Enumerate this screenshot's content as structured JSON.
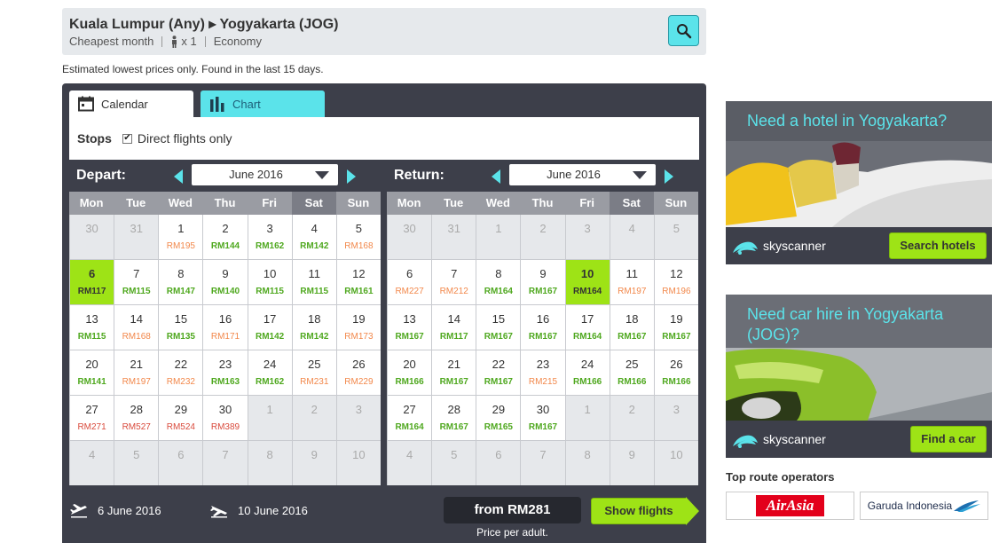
{
  "search": {
    "route": "Kuala Lumpur (Any) ▸ Yogyakarta (JOG)",
    "when": "Cheapest month",
    "passengers": "x 1",
    "cabin": "Economy",
    "note": "Estimated lowest prices only. Found in the last 15 days."
  },
  "tabs": {
    "calendar": "Calendar",
    "chart": "Chart"
  },
  "filters": {
    "stops_label": "Stops",
    "direct_label": "Direct flights only",
    "direct_checked": "✔"
  },
  "days": [
    "Mon",
    "Tue",
    "Wed",
    "Thu",
    "Fri",
    "Sat",
    "Sun"
  ],
  "depart": {
    "label": "Depart:",
    "month": "June 2016",
    "cells": [
      {
        "d": "30",
        "p": "",
        "c": "",
        "out": true
      },
      {
        "d": "31",
        "p": "",
        "c": "",
        "out": true
      },
      {
        "d": "1",
        "p": "RM195",
        "c": "orange"
      },
      {
        "d": "2",
        "p": "RM144",
        "c": "green"
      },
      {
        "d": "3",
        "p": "RM162",
        "c": "green"
      },
      {
        "d": "4",
        "p": "RM142",
        "c": "green"
      },
      {
        "d": "5",
        "p": "RM168",
        "c": "orange"
      },
      {
        "d": "6",
        "p": "RM117",
        "c": "green",
        "sel": true
      },
      {
        "d": "7",
        "p": "RM115",
        "c": "green"
      },
      {
        "d": "8",
        "p": "RM147",
        "c": "green"
      },
      {
        "d": "9",
        "p": "RM140",
        "c": "green"
      },
      {
        "d": "10",
        "p": "RM115",
        "c": "green"
      },
      {
        "d": "11",
        "p": "RM115",
        "c": "green"
      },
      {
        "d": "12",
        "p": "RM161",
        "c": "green"
      },
      {
        "d": "13",
        "p": "RM115",
        "c": "green"
      },
      {
        "d": "14",
        "p": "RM168",
        "c": "orange"
      },
      {
        "d": "15",
        "p": "RM135",
        "c": "green"
      },
      {
        "d": "16",
        "p": "RM171",
        "c": "orange"
      },
      {
        "d": "17",
        "p": "RM142",
        "c": "green"
      },
      {
        "d": "18",
        "p": "RM142",
        "c": "green"
      },
      {
        "d": "19",
        "p": "RM173",
        "c": "orange"
      },
      {
        "d": "20",
        "p": "RM141",
        "c": "green"
      },
      {
        "d": "21",
        "p": "RM197",
        "c": "orange"
      },
      {
        "d": "22",
        "p": "RM232",
        "c": "orange"
      },
      {
        "d": "23",
        "p": "RM163",
        "c": "green"
      },
      {
        "d": "24",
        "p": "RM162",
        "c": "green"
      },
      {
        "d": "25",
        "p": "RM231",
        "c": "orange"
      },
      {
        "d": "26",
        "p": "RM229",
        "c": "orange"
      },
      {
        "d": "27",
        "p": "RM271",
        "c": "red"
      },
      {
        "d": "28",
        "p": "RM527",
        "c": "red"
      },
      {
        "d": "29",
        "p": "RM524",
        "c": "red"
      },
      {
        "d": "30",
        "p": "RM389",
        "c": "red"
      },
      {
        "d": "1",
        "p": "",
        "c": "",
        "out": true
      },
      {
        "d": "2",
        "p": "",
        "c": "",
        "out": true
      },
      {
        "d": "3",
        "p": "",
        "c": "",
        "out": true
      },
      {
        "d": "4",
        "p": "",
        "c": "",
        "out": true
      },
      {
        "d": "5",
        "p": "",
        "c": "",
        "out": true
      },
      {
        "d": "6",
        "p": "",
        "c": "",
        "out": true
      },
      {
        "d": "7",
        "p": "",
        "c": "",
        "out": true
      },
      {
        "d": "8",
        "p": "",
        "c": "",
        "out": true
      },
      {
        "d": "9",
        "p": "",
        "c": "",
        "out": true
      },
      {
        "d": "10",
        "p": "",
        "c": "",
        "out": true
      }
    ]
  },
  "return": {
    "label": "Return:",
    "month": "June 2016",
    "cells": [
      {
        "d": "30",
        "p": "",
        "c": "",
        "out": true
      },
      {
        "d": "31",
        "p": "",
        "c": "",
        "out": true
      },
      {
        "d": "1",
        "p": "",
        "c": "",
        "out": true
      },
      {
        "d": "2",
        "p": "",
        "c": "",
        "out": true
      },
      {
        "d": "3",
        "p": "",
        "c": "",
        "out": true
      },
      {
        "d": "4",
        "p": "",
        "c": "",
        "out": true
      },
      {
        "d": "5",
        "p": "",
        "c": "",
        "out": true
      },
      {
        "d": "6",
        "p": "RM227",
        "c": "orange"
      },
      {
        "d": "7",
        "p": "RM212",
        "c": "orange"
      },
      {
        "d": "8",
        "p": "RM164",
        "c": "green"
      },
      {
        "d": "9",
        "p": "RM167",
        "c": "green"
      },
      {
        "d": "10",
        "p": "RM164",
        "c": "green",
        "sel": true
      },
      {
        "d": "11",
        "p": "RM197",
        "c": "orange"
      },
      {
        "d": "12",
        "p": "RM196",
        "c": "orange"
      },
      {
        "d": "13",
        "p": "RM167",
        "c": "green"
      },
      {
        "d": "14",
        "p": "RM117",
        "c": "green"
      },
      {
        "d": "15",
        "p": "RM167",
        "c": "green"
      },
      {
        "d": "16",
        "p": "RM167",
        "c": "green"
      },
      {
        "d": "17",
        "p": "RM164",
        "c": "green"
      },
      {
        "d": "18",
        "p": "RM167",
        "c": "green"
      },
      {
        "d": "19",
        "p": "RM167",
        "c": "green"
      },
      {
        "d": "20",
        "p": "RM166",
        "c": "green"
      },
      {
        "d": "21",
        "p": "RM167",
        "c": "green"
      },
      {
        "d": "22",
        "p": "RM167",
        "c": "green"
      },
      {
        "d": "23",
        "p": "RM215",
        "c": "orange"
      },
      {
        "d": "24",
        "p": "RM166",
        "c": "green"
      },
      {
        "d": "25",
        "p": "RM166",
        "c": "green"
      },
      {
        "d": "26",
        "p": "RM166",
        "c": "green"
      },
      {
        "d": "27",
        "p": "RM164",
        "c": "green"
      },
      {
        "d": "28",
        "p": "RM167",
        "c": "green"
      },
      {
        "d": "29",
        "p": "RM165",
        "c": "green"
      },
      {
        "d": "30",
        "p": "RM167",
        "c": "green"
      },
      {
        "d": "1",
        "p": "",
        "c": "",
        "out": true
      },
      {
        "d": "2",
        "p": "",
        "c": "",
        "out": true
      },
      {
        "d": "3",
        "p": "",
        "c": "",
        "out": true
      },
      {
        "d": "4",
        "p": "",
        "c": "",
        "out": true
      },
      {
        "d": "5",
        "p": "",
        "c": "",
        "out": true
      },
      {
        "d": "6",
        "p": "",
        "c": "",
        "out": true
      },
      {
        "d": "7",
        "p": "",
        "c": "",
        "out": true
      },
      {
        "d": "8",
        "p": "",
        "c": "",
        "out": true
      },
      {
        "d": "9",
        "p": "",
        "c": "",
        "out": true
      },
      {
        "d": "10",
        "p": "",
        "c": "",
        "out": true
      }
    ]
  },
  "summary": {
    "depart_date": "6 June 2016",
    "return_date": "10 June 2016",
    "price": "from RM281",
    "price_note": "Price per adult.",
    "show_button": "Show flights"
  },
  "ads": {
    "hotel": {
      "title": "Need a hotel in Yogyakarta?",
      "brand": "skyscanner",
      "button": "Search hotels"
    },
    "car": {
      "title": "Need car hire in Yogyakarta (JOG)?",
      "brand": "skyscanner",
      "button": "Find a car"
    }
  },
  "operators": {
    "label": "Top route operators",
    "airasia": "AirAsia",
    "garuda": "Garuda Indonesia"
  },
  "colors": {
    "accent": "#5be3ea",
    "cta": "#9ee316",
    "panel": "#3d3f4a",
    "cheap": "#4fa81f",
    "mid": "#f2884b",
    "expensive": "#d94a3c"
  }
}
